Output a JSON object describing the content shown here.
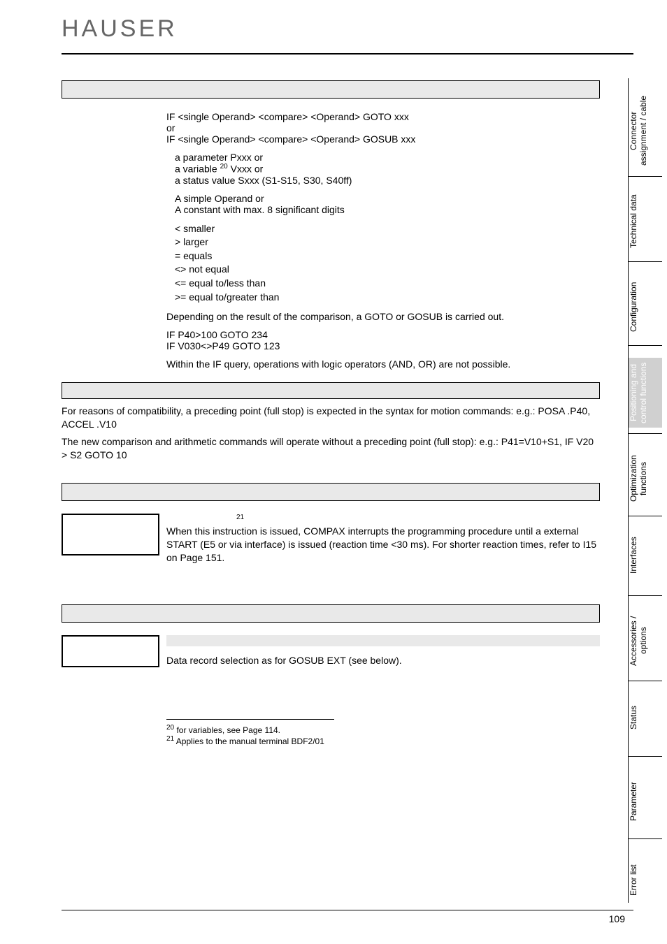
{
  "logo_text": "HAUSER",
  "syntax_line1": "IF <single Operand> <compare> <Operand> GOTO xxx",
  "syntax_or": "or",
  "syntax_line2": "IF <single Operand> <compare> <Operand> GOSUB xxx",
  "operand_defs": {
    "line1": "a parameter Pxxx or",
    "line2_pre": "a variable ",
    "line2_sup": "20",
    "line2_post": " Vxxx or",
    "line3": "a status value Sxxx  (S1-S15, S30, S40ff)"
  },
  "operand_b": {
    "line1": "A simple Operand or",
    "line2": "A constant with max. 8 significant digits"
  },
  "compare_ops": {
    "lt": "< smaller",
    "gt": "> larger",
    "eq": "= equals",
    "ne": "<>   not equal",
    "le": "<=   equal to/less than",
    "ge": ">=   equal to/greater than"
  },
  "depending": "Depending on the result of the comparison, a GOTO or GOSUB is carried out.",
  "examples": {
    "e1": "IF P40>100 GOTO 234",
    "e2": "IF V030<>P49 GOTO 123"
  },
  "if_note": "Within the IF query, operations with logic operators (AND, OR) are not possible.",
  "compat1": "For reasons of compatibility, a preceding point (full stop) is expected in the syntax for motion commands: e.g.: POSA .P40, ACCEL .V10",
  "compat2": "The new comparison and arithmetic commands will operate without a preceding point (full stop): e.g.: P41=V10+S1, IF V20 > S2 GOTO 10",
  "wait": {
    "sup": "21",
    "text": "When this instruction is issued, COMPAX interrupts the programming procedure until a external START (E5 or via interface) is issued (reaction time <30 ms). For shorter reaction times, refer to I15 on Page 151."
  },
  "goto_ext": "Data record selection as for GOSUB EXT (see below).",
  "footnotes": {
    "f20": " for variables, see Page 114.",
    "f21": " Applies to the manual terminal BDF2/01"
  },
  "page_number": "109",
  "sidebar": {
    "t1a": "Connector",
    "t1b": "assignment / cable",
    "t2": "Technical data",
    "t3": "Configuration",
    "t4a": "Positioning and",
    "t4b": "control functions",
    "t5a": "Optimization",
    "t5b": "functions",
    "t6": "Interfaces",
    "t7a": "Accessories /",
    "t7b": "options",
    "t8": "Status",
    "t9": "Parameter",
    "t10": "Error list"
  }
}
